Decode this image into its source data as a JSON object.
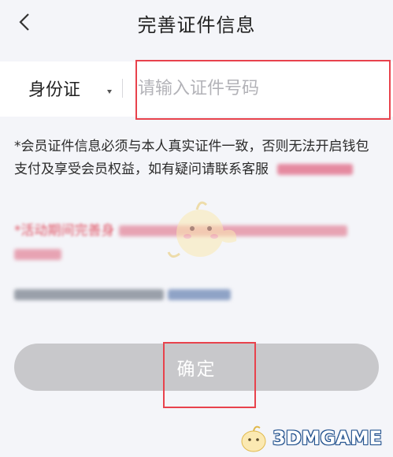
{
  "header": {
    "title": "完善证件信息"
  },
  "form": {
    "id_type_label": "身份证",
    "id_number_placeholder": "请输入证件号码"
  },
  "notice": {
    "text": "*会员证件信息必须与本人真实证件一致，否则无法开启钱包支付及享受会员权益，如有疑问请联系客服",
    "blurred_phone": "",
    "red_prefix": "*活动期间完善身"
  },
  "confirm_button": {
    "label": "确定"
  },
  "watermark": {
    "text": "3DMGAME"
  },
  "colors": {
    "background": "#f4f5f9",
    "button_disabled": "#c8c8cb",
    "highlight_red": "#e8424c",
    "notice_red": "#e05566",
    "link_blue": "#4a6fa5"
  }
}
